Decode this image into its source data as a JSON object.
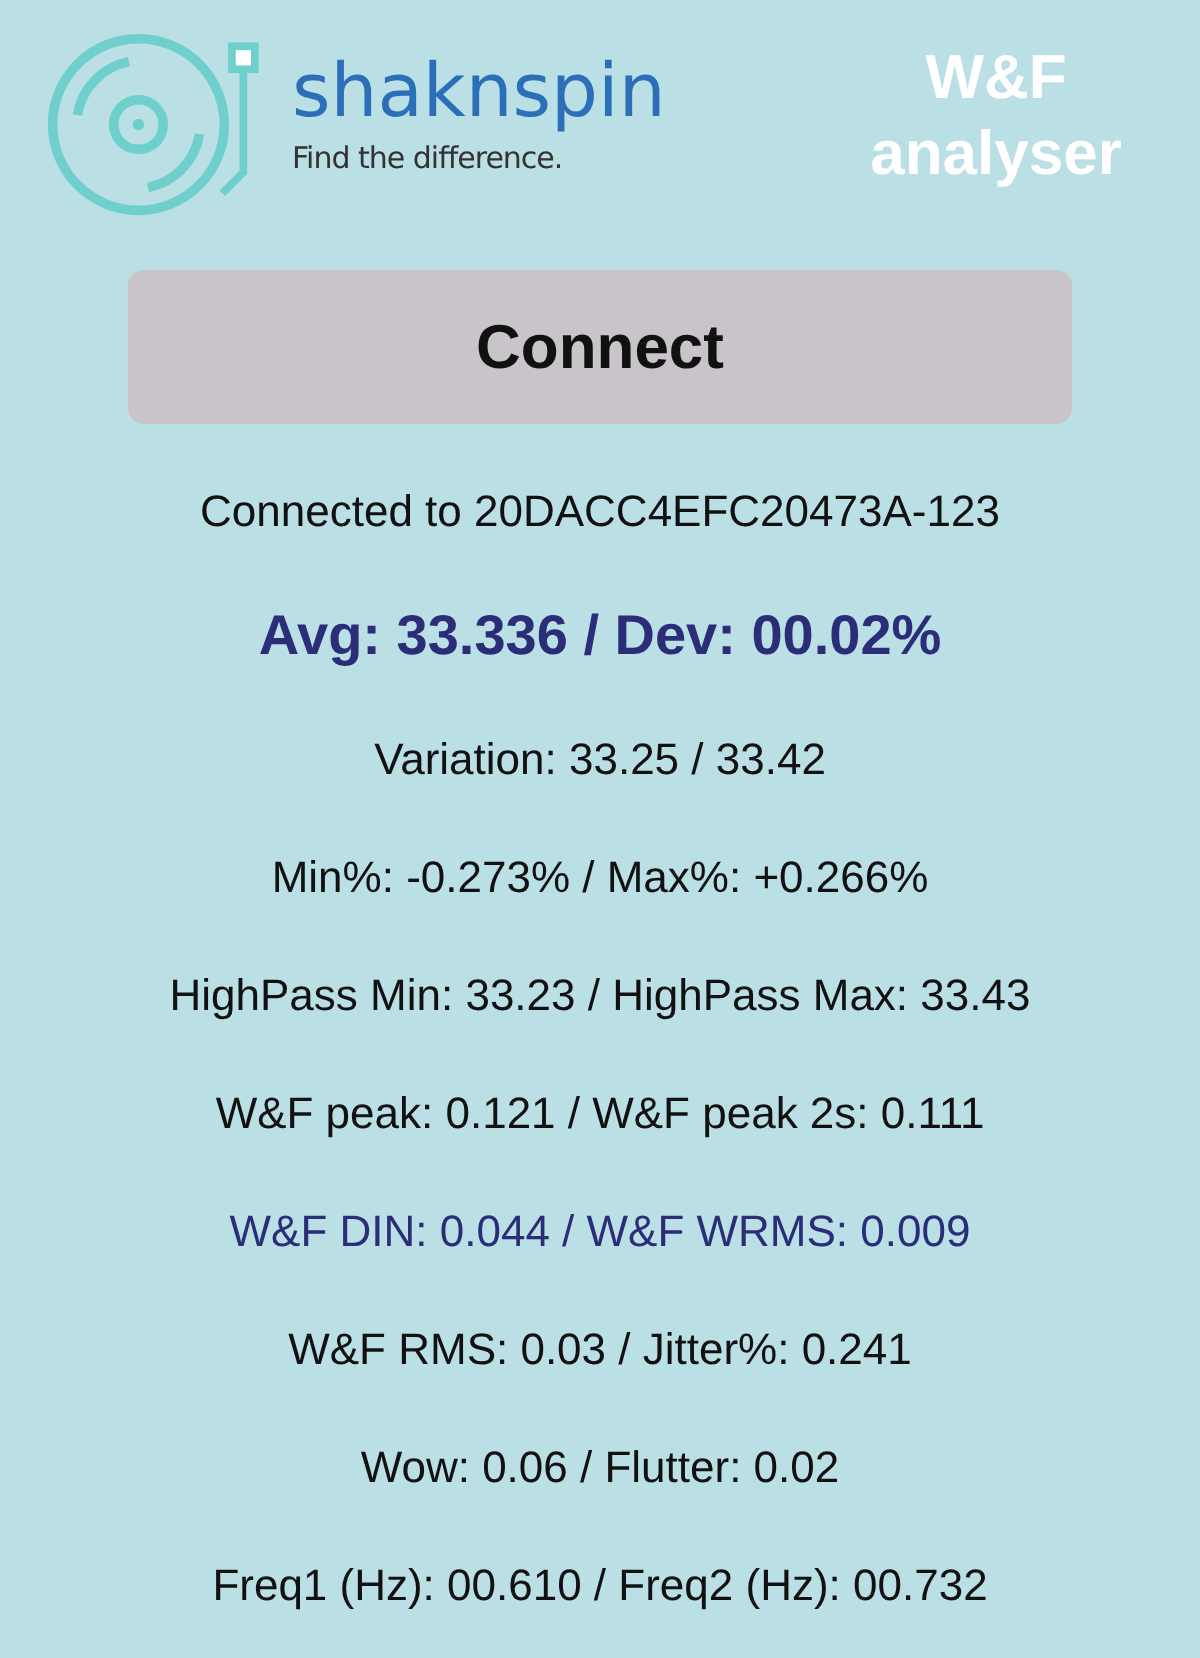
{
  "logo": {
    "name": "shaknspin",
    "tagline": "Find the difference."
  },
  "title": "W&F analyser",
  "connect_button": {
    "label": "Connect"
  },
  "status": "Connected to 20DACC4EFC20473A-123",
  "readings": [
    {
      "kind": "headline",
      "text": "Avg: 33.336  /  Dev: 00.02%"
    },
    {
      "kind": "normal",
      "text": "Variation: 33.25 / 33.42"
    },
    {
      "kind": "normal",
      "text": "Min%: -0.273% / Max%: +0.266%"
    },
    {
      "kind": "normal",
      "text": "HighPass Min: 33.23 / HighPass Max: 33.43"
    },
    {
      "kind": "normal",
      "text": "W&F peak: 0.121 / W&F peak 2s: 0.111"
    },
    {
      "kind": "accent",
      "text": "W&F DIN: 0.044 / W&F WRMS: 0.009"
    },
    {
      "kind": "normal",
      "text": "W&F RMS: 0.03 / Jitter%: 0.241"
    },
    {
      "kind": "normal",
      "text": "Wow: 0.06 / Flutter: 0.02"
    },
    {
      "kind": "normal",
      "text": "Freq1 (Hz): 00.610 / Freq2 (Hz): 00.732"
    }
  ]
}
